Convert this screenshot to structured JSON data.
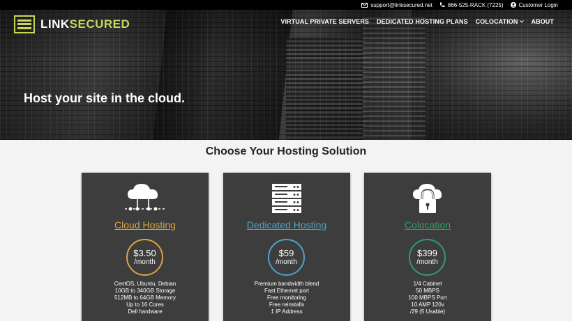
{
  "topbar": {
    "email": "support@linksecured.net",
    "phone": "866-525-RACK (7225)",
    "login": "Customer Login"
  },
  "brand": {
    "link": "LINK",
    "secured": "SECURED",
    "accent_color": "#c9d65a"
  },
  "nav": {
    "vps": "VIRTUAL PRIVATE SERVERS",
    "dedicated": "DEDICATED HOSTING PLANS",
    "colocation": "COLOCATION",
    "about": "ABOUT"
  },
  "hero": {
    "title": "Host your site in the cloud."
  },
  "main": {
    "title": "Choose Your Hosting Solution",
    "cards": [
      {
        "name": "Cloud Hosting",
        "icon": "cloud-network-icon",
        "color": "#d9a741",
        "price": "$3.50",
        "per": "/month",
        "features": [
          "CentOS, Ubuntu, Debian",
          "10GB to 340GB Storage",
          "512MB to 64GB Memory",
          "Up to 16 Cores",
          "Dell hardware"
        ]
      },
      {
        "name": "Dedicated Hosting",
        "icon": "server-rack-icon",
        "color": "#4fa3c7",
        "price": "$59",
        "per": "/month",
        "features": [
          "Premium bandwidth blend",
          "Fast Ethernet port",
          "Free monitoring",
          "Free reinstalls",
          "1 IP Address"
        ]
      },
      {
        "name": "Colocation",
        "icon": "cloud-lock-icon",
        "color": "#2f9e6a",
        "price": "$399",
        "per": "/month",
        "features": [
          "1/4 Cabinet",
          "50 MBPS",
          "100 MBPS Port",
          "10 AMP 120v",
          "/29 (5 Usable)"
        ]
      }
    ]
  }
}
